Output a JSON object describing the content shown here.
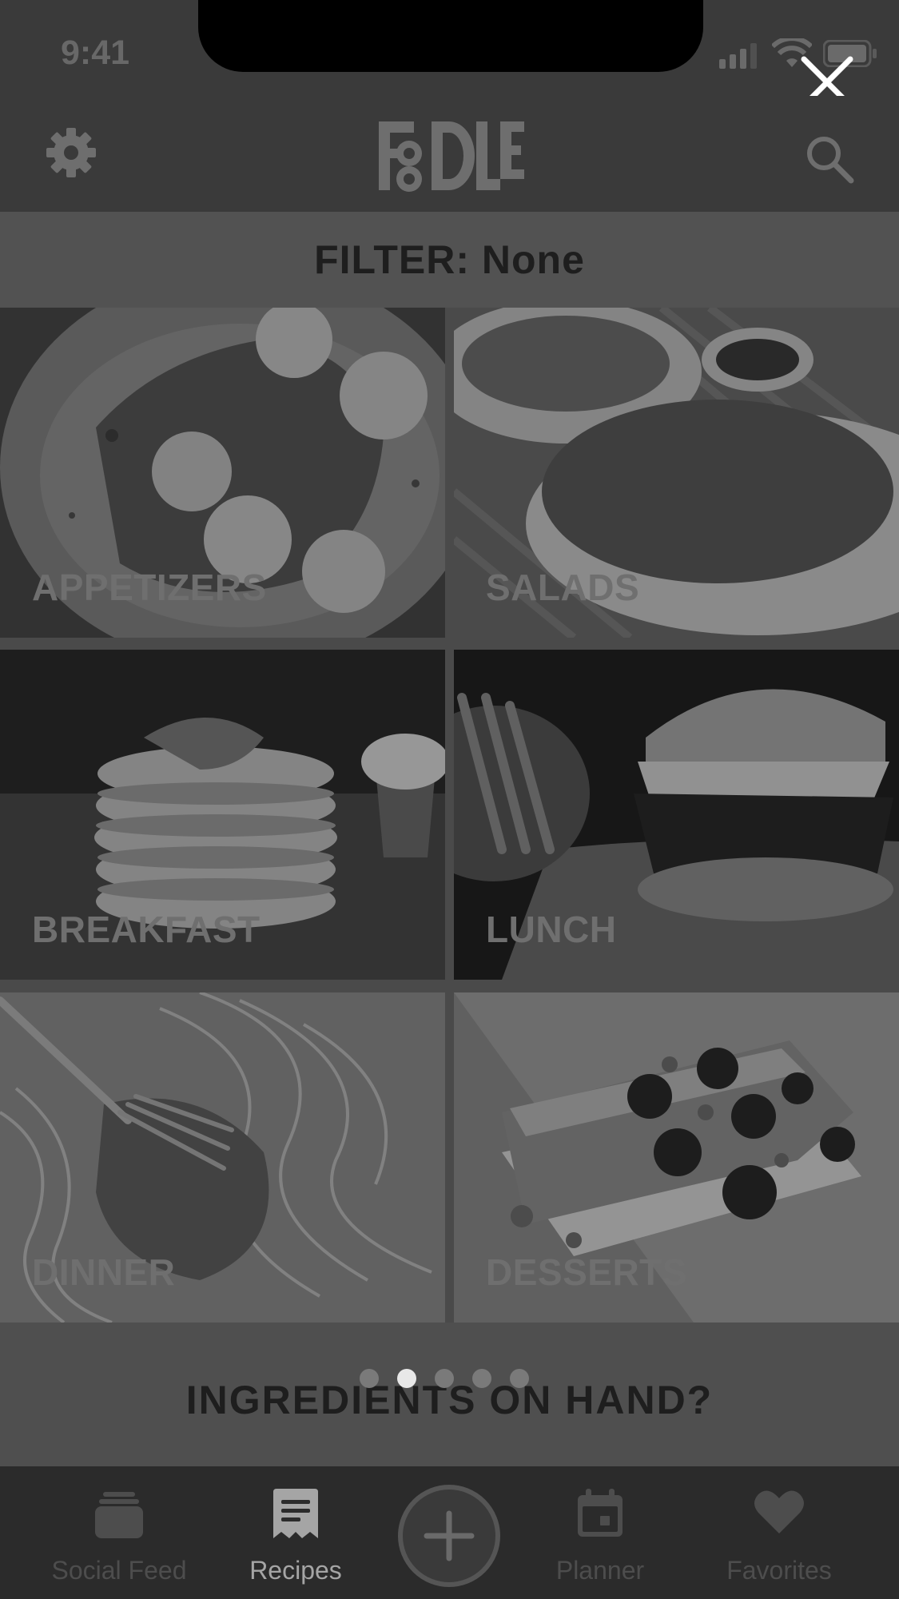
{
  "status_bar": {
    "time": "9:41"
  },
  "header": {
    "logo_text": "FOODLE",
    "settings_icon": "gear-icon",
    "search_icon": "search-icon"
  },
  "close_icon": "close-icon",
  "filter": {
    "label": "FILTER: None"
  },
  "categories": [
    {
      "label": "APPETIZERS"
    },
    {
      "label": "SALADS"
    },
    {
      "label": "BREAKFAST"
    },
    {
      "label": "LUNCH"
    },
    {
      "label": "DINNER"
    },
    {
      "label": "DESSERTS"
    }
  ],
  "ingredients": {
    "label": "INGREDIENTS ON HAND?",
    "page_count": 5,
    "active_page": 2
  },
  "tab_bar": {
    "tabs": [
      {
        "label": "Social Feed",
        "icon": "stack-icon",
        "active": false
      },
      {
        "label": "Recipes",
        "icon": "recipe-card-icon",
        "active": true
      },
      {
        "label": "Planner",
        "icon": "calendar-icon",
        "active": false
      },
      {
        "label": "Favorites",
        "icon": "heart-icon",
        "active": false
      }
    ],
    "center_button_icon": "plus-icon"
  },
  "colors": {
    "background": "#3b3b3b",
    "bar": "#525252",
    "tab_bar": "#2b2b2b",
    "active_dot": "#e8e8e8"
  }
}
